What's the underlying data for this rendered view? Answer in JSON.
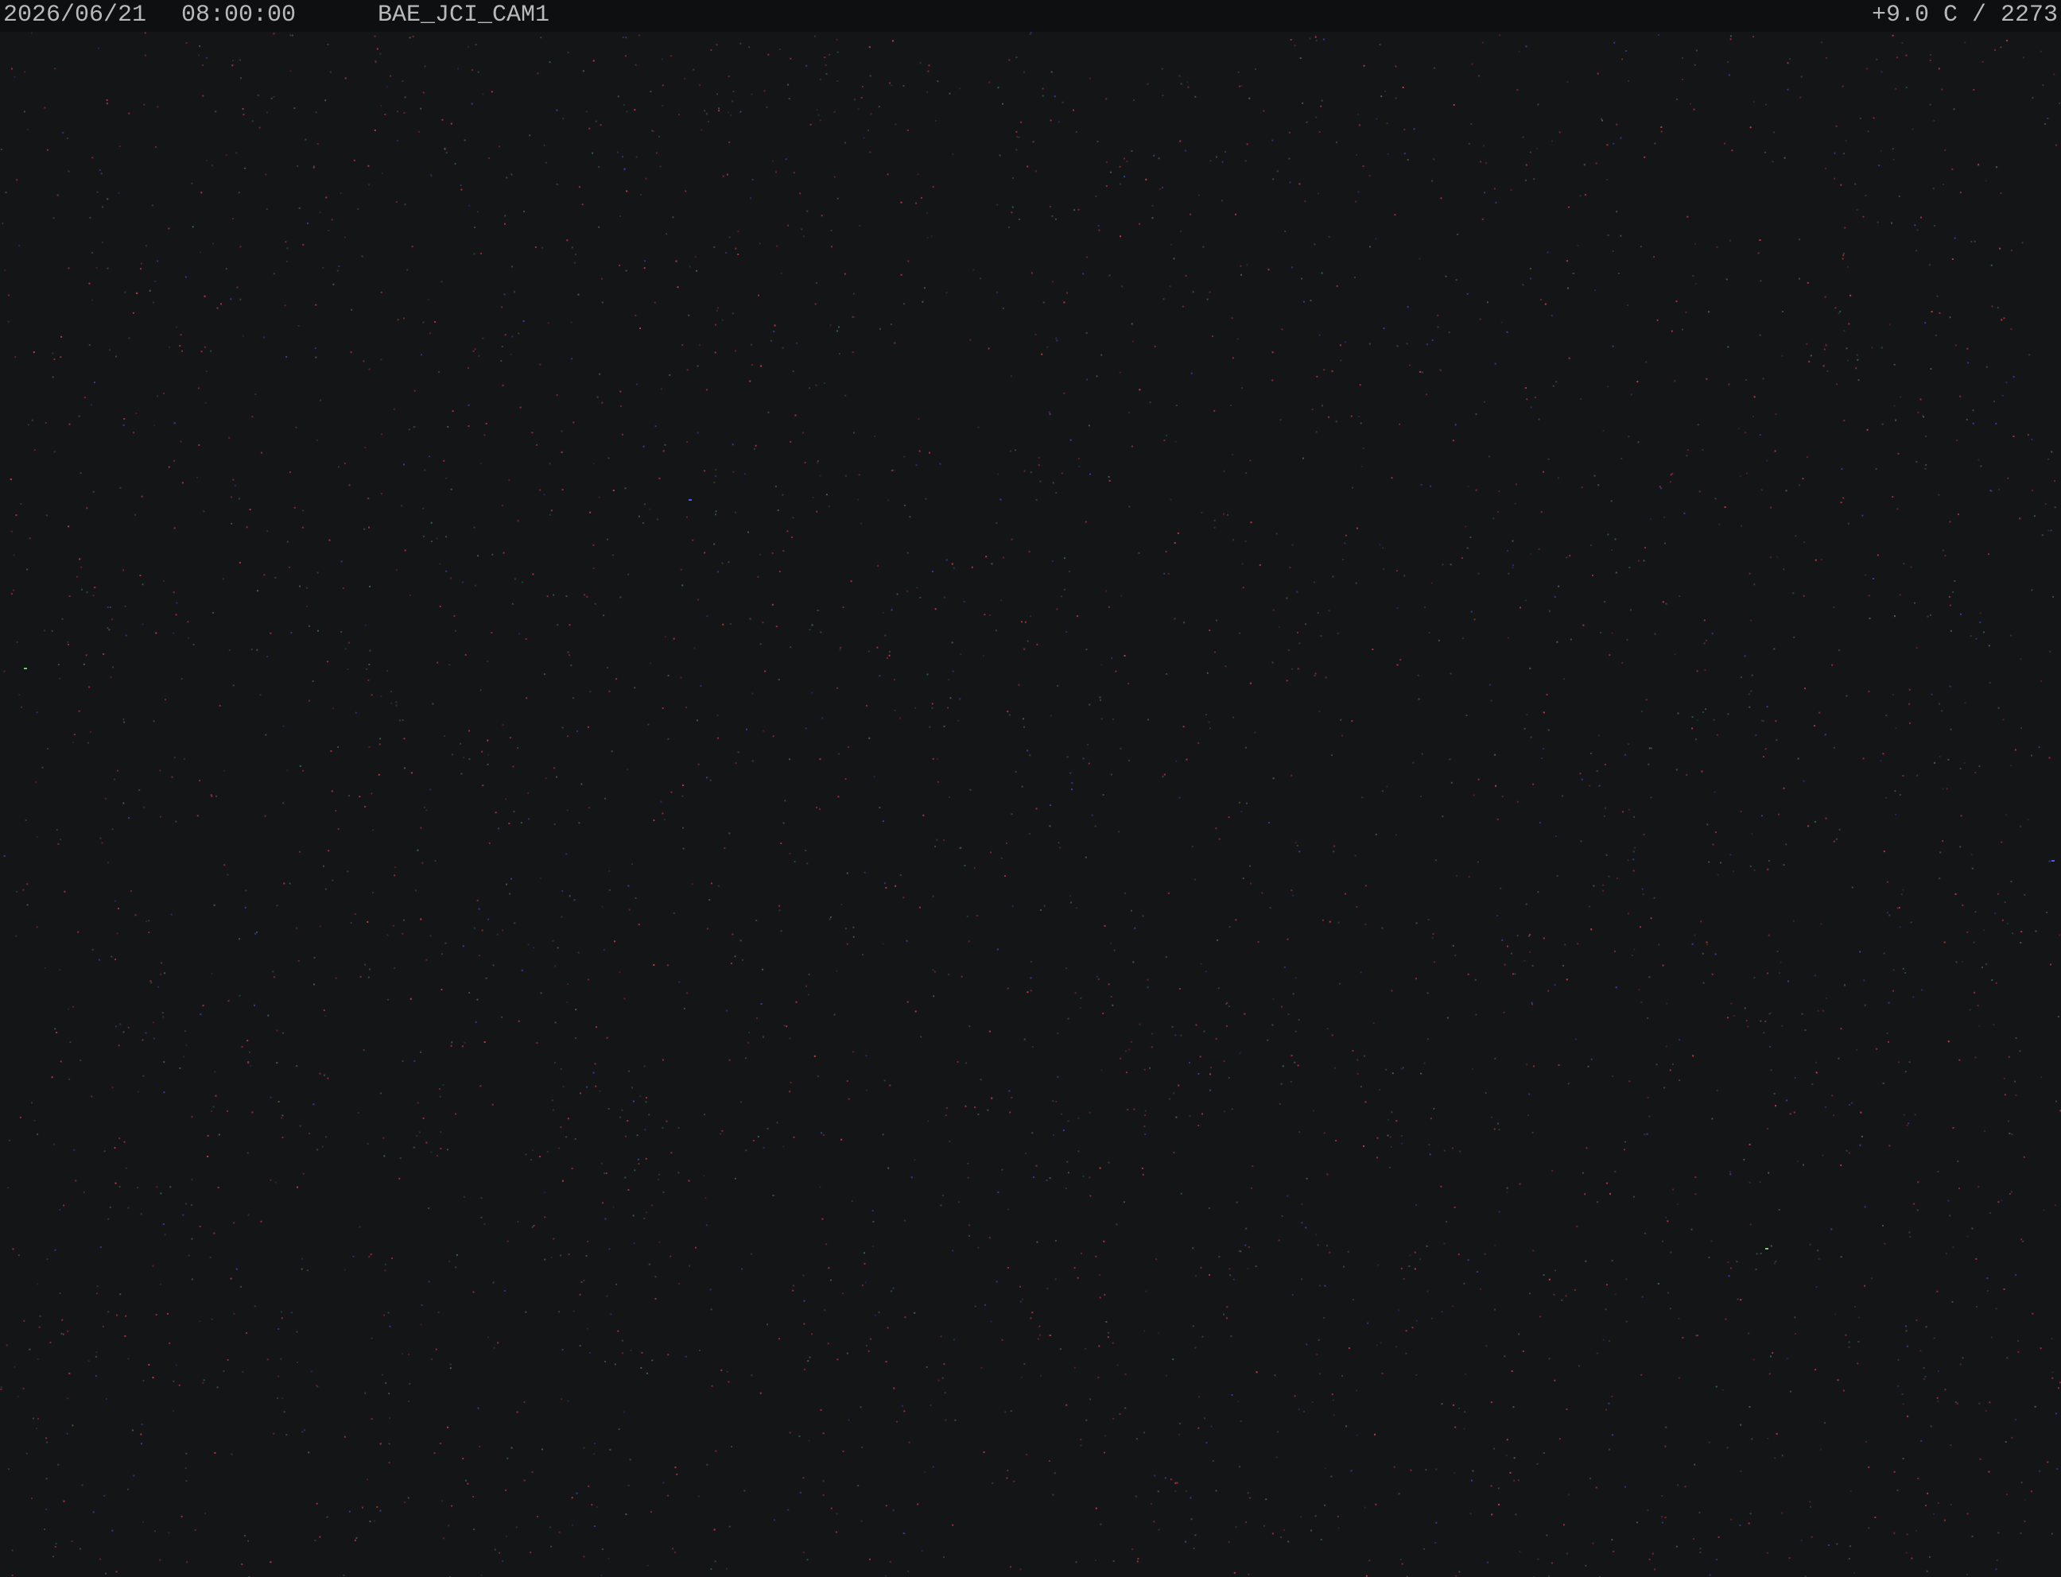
{
  "overlay": {
    "date": "2026/06/21",
    "time": "08:00:00",
    "camera_name": "BAE_JCI_CAM1",
    "readout": "+9.0 C / 2273"
  },
  "colors": {
    "background": "#141516",
    "overlay_bar": "#0e0f10",
    "overlay_text": "#b9b9b9"
  }
}
